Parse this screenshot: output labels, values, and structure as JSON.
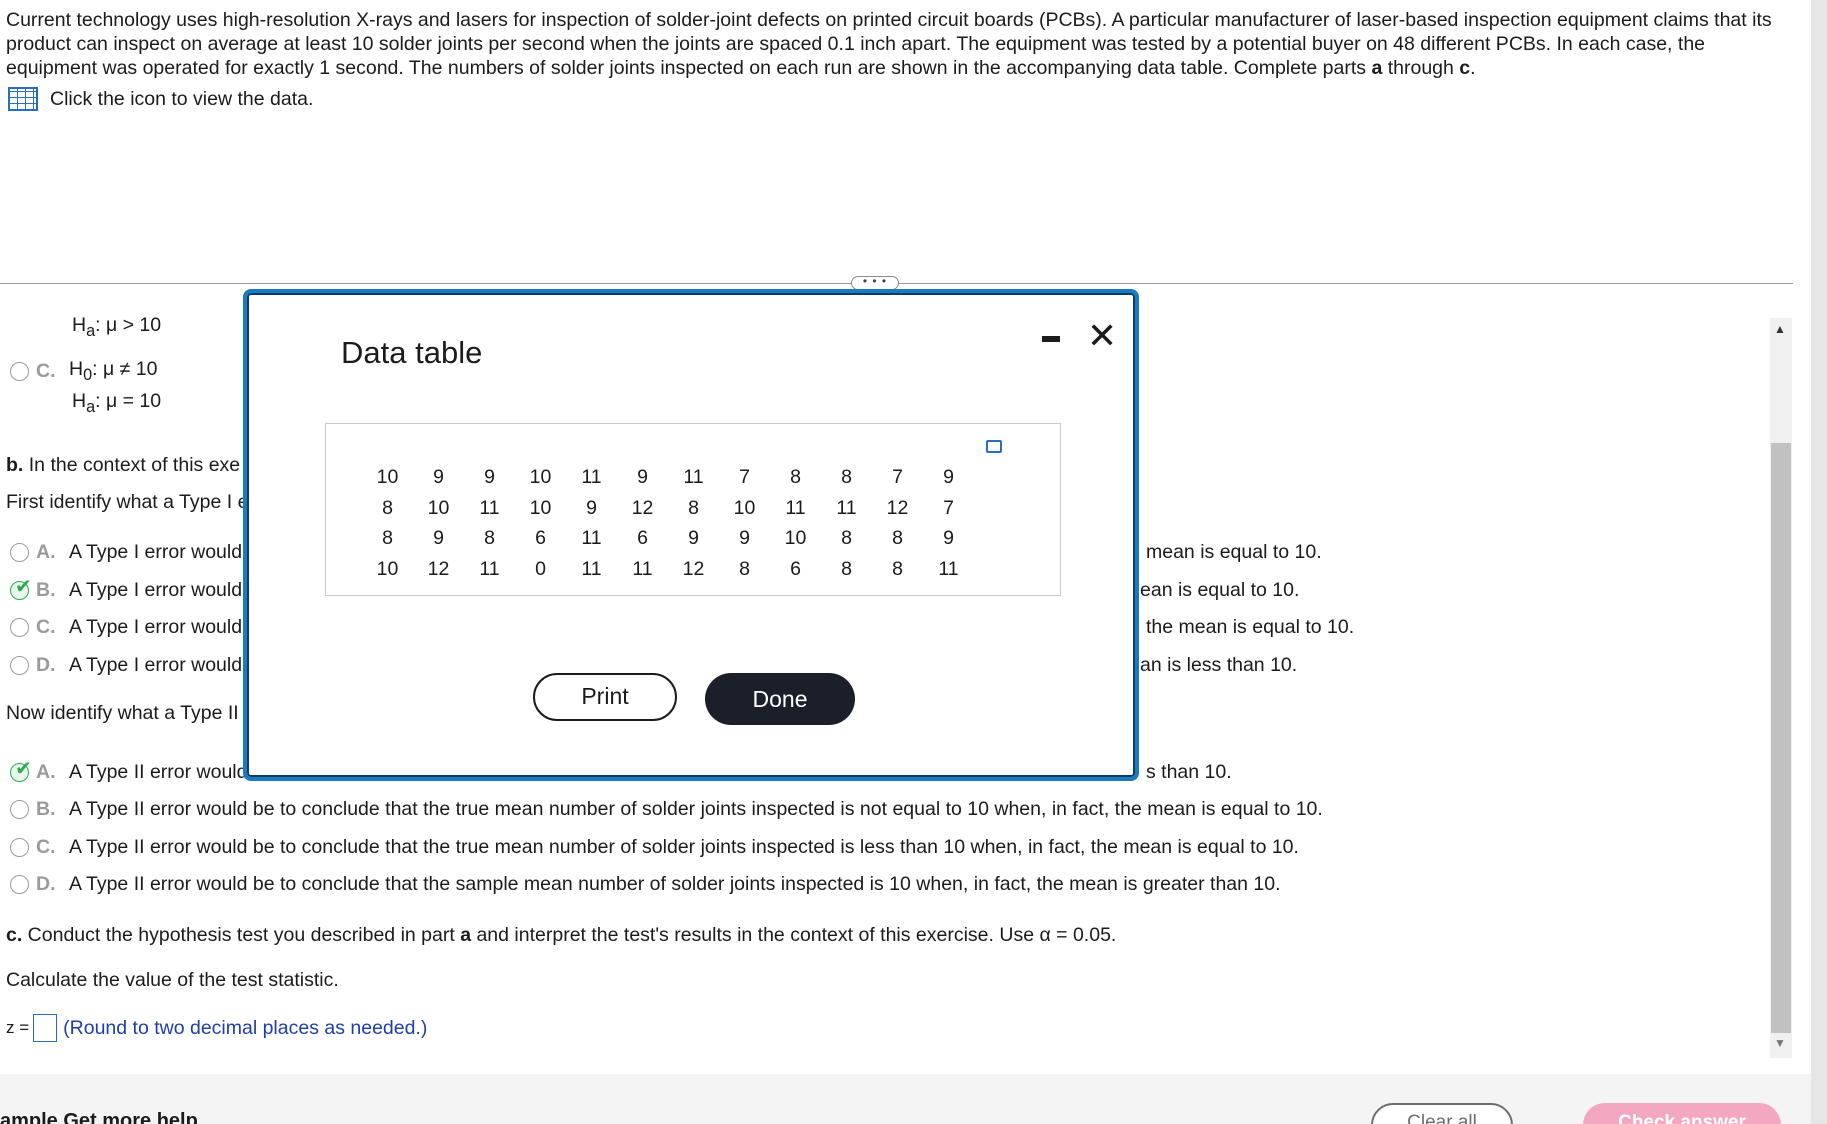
{
  "problem": {
    "text_before_a": "Current technology uses high-resolution X-rays and lasers for inspection of solder-joint defects on printed circuit boards (PCBs). A particular manufacturer of laser-based inspection equipment claims that its product can inspect on average at least 10 solder joints per second when the joints are spaced 0.1 inch apart. The equipment was tested by a potential buyer on 48 different PCBs. In each case, the equipment was operated for exactly 1 second. The numbers of solder joints inspected on each run are shown in the accompanying data table. Complete parts ",
    "a": "a",
    "through": " through ",
    "c": "c",
    "period": ".",
    "data_link": "Click the icon to view the data.",
    "data_link_icon": "table-grid-icon"
  },
  "divider_handle": "• • •",
  "part_a": {
    "ha_top": "H",
    "ha_top_sub": "a",
    "ha_top_rest": ": μ > 10",
    "option_c_letter": "C.",
    "option_c_h0": "H",
    "option_c_h0_sub": "0",
    "option_c_h0_rest": ": μ ≠ 10",
    "option_c_ha": "H",
    "option_c_ha_sub": "a",
    "option_c_ha_rest": ": μ = 10"
  },
  "part_b": {
    "label": "b.",
    "intro": " In the context of this exe",
    "type1_prompt": "First identify what a Type I e",
    "type1_options": [
      {
        "letter": "A.",
        "left_text": "A Type I error would",
        "right_text": "mean is equal to 10.",
        "selected": false
      },
      {
        "letter": "B.",
        "left_text": "A Type I error would",
        "right_text": "ean is equal to 10.",
        "selected": true
      },
      {
        "letter": "C.",
        "left_text": "A Type I error would",
        "right_text": "the mean is equal to 10.",
        "selected": false
      },
      {
        "letter": "D.",
        "left_text": "A Type I error would",
        "right_text": "an is less than 10.",
        "selected": false
      }
    ],
    "type2_prompt": "Now identify what a Type II",
    "type2_options": [
      {
        "letter": "A.",
        "text": "A Type II error would",
        "right_text": "s than 10.",
        "selected": true
      },
      {
        "letter": "B.",
        "text": "A Type II error would be to conclude that the true mean number of solder joints inspected is not equal to 10 when, in fact, the mean is equal to 10.",
        "selected": false
      },
      {
        "letter": "C.",
        "text": "A Type II error would be to conclude that the true mean number of solder joints inspected is less than 10 when, in fact, the mean is equal to 10.",
        "selected": false
      },
      {
        "letter": "D.",
        "text": "A Type II error would be to conclude that the sample mean number of solder joints inspected is 10 when, in fact, the mean is greater than 10.",
        "selected": false
      }
    ]
  },
  "part_c": {
    "label": "c.",
    "text_before": " Conduct the hypothesis test you described in part ",
    "a": "a",
    "text_after": " and interpret the test's results in the context of this exercise. Use α = 0.05.",
    "calc_prompt": "Calculate the value of the test statistic.",
    "z_label": "z =",
    "z_value": "",
    "hint": "(Round to two decimal places as needed.)"
  },
  "footer": {
    "links_text": "ample     Get more help",
    "clear_all": "Clear all",
    "check_answer": "Check answer"
  },
  "modal": {
    "title": "Data table",
    "minimize_icon": "minimize-icon",
    "close_icon": "close-x-icon",
    "copy_icon": "copy-icon",
    "rows": [
      [
        "10",
        "9",
        "9",
        "10",
        "11",
        "9",
        "11",
        "7",
        "8",
        "8",
        "7",
        "9"
      ],
      [
        "8",
        "10",
        "11",
        "10",
        "9",
        "12",
        "8",
        "10",
        "11",
        "11",
        "12",
        "7"
      ],
      [
        "8",
        "9",
        "8",
        "6",
        "11",
        "6",
        "9",
        "9",
        "10",
        "8",
        "8",
        "9"
      ],
      [
        "10",
        "12",
        "11",
        "0",
        "11",
        "11",
        "12",
        "8",
        "6",
        "8",
        "8",
        "11"
      ]
    ],
    "print_label": "Print",
    "done_label": "Done"
  }
}
